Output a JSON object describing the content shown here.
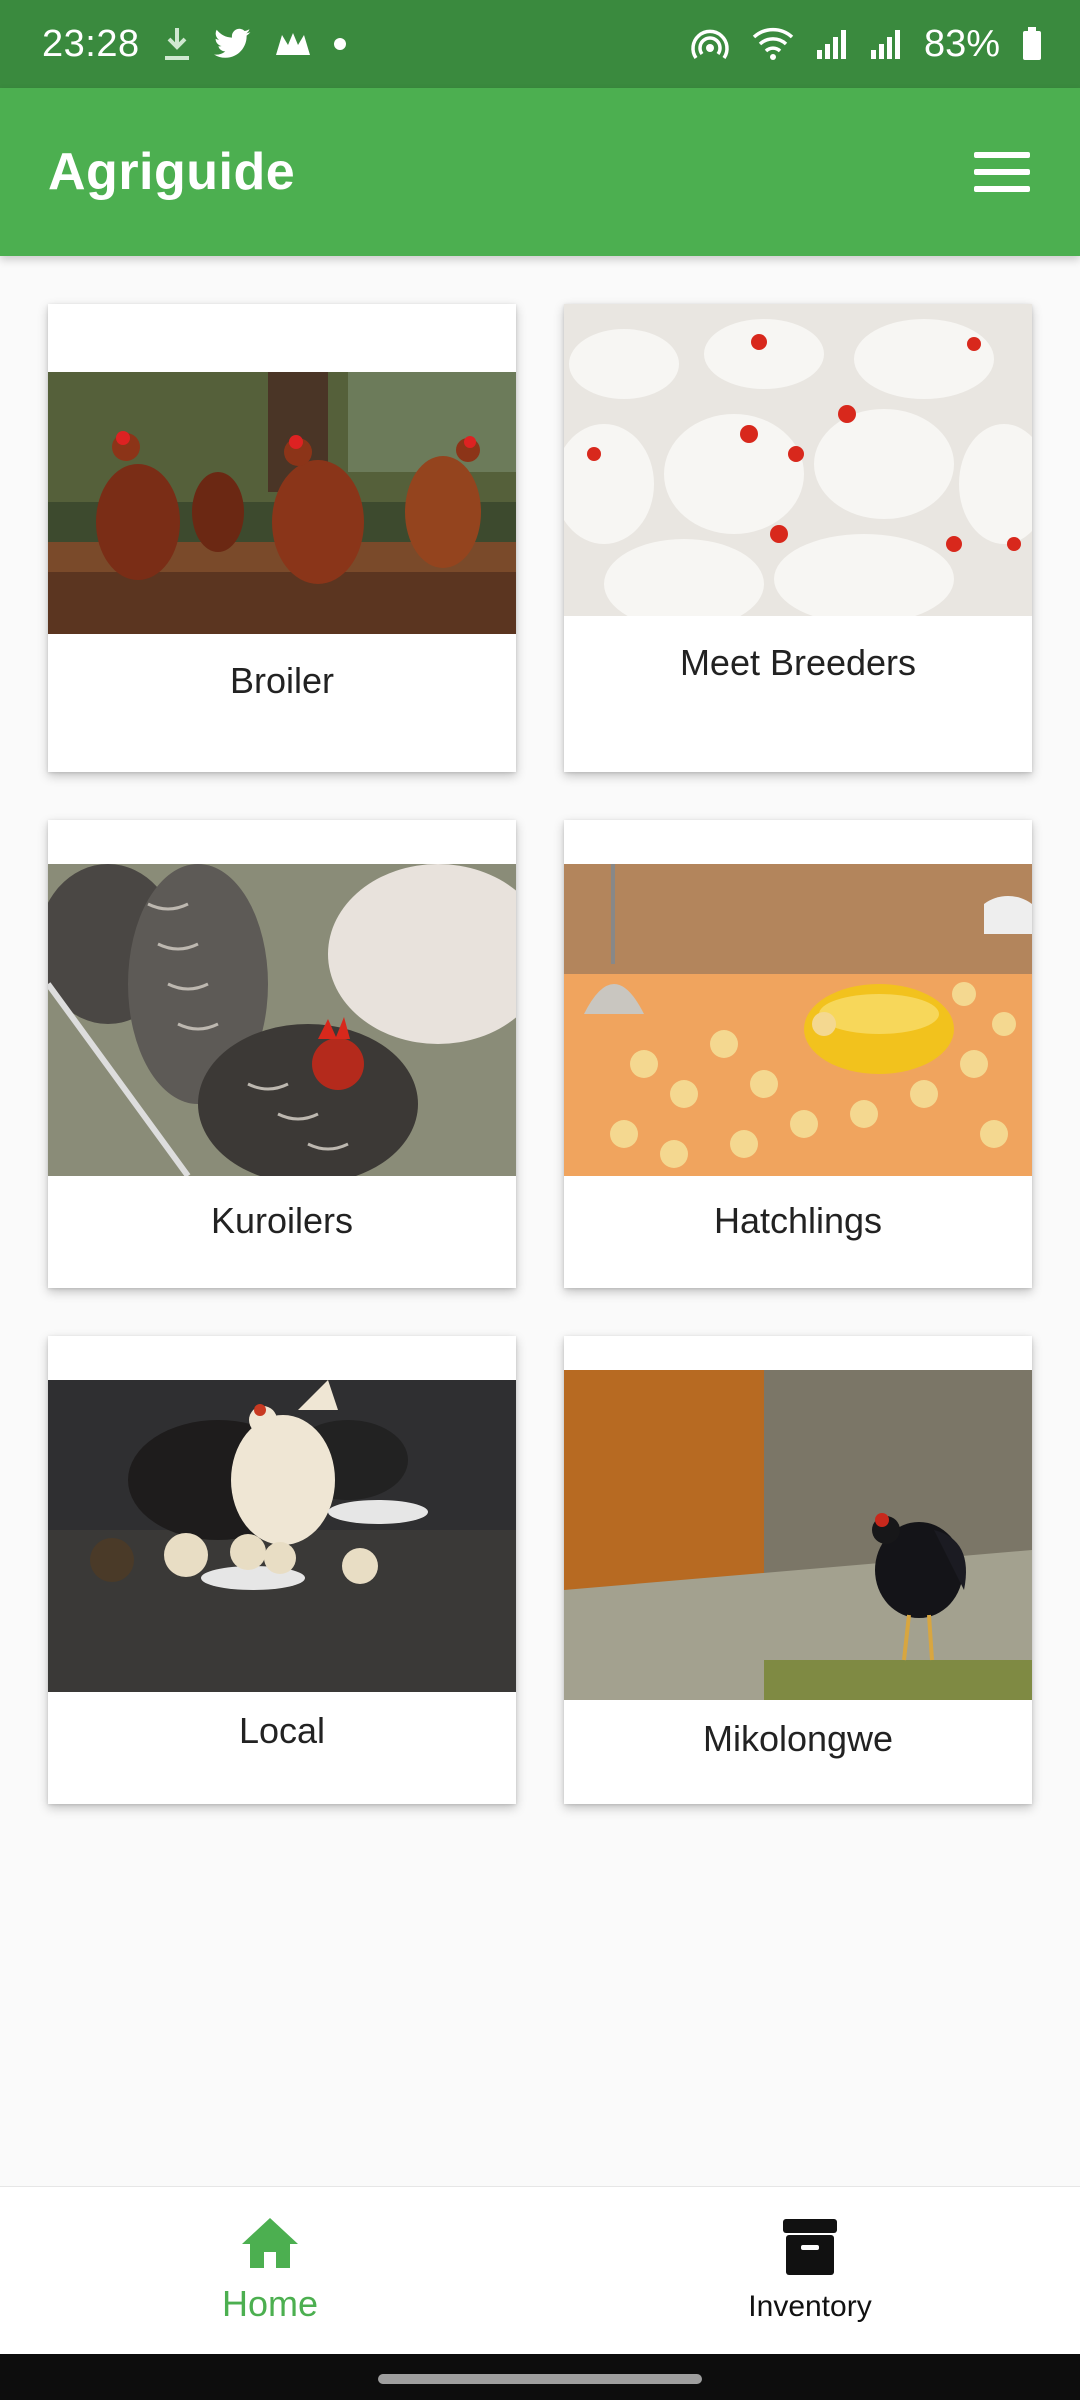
{
  "status_bar": {
    "time": "23:28",
    "battery": "83%",
    "icons_left": [
      "download-icon",
      "twitter-icon",
      "bird-app-icon",
      "notification-dot"
    ],
    "icons_right": [
      "hotspot-icon",
      "wifi-icon",
      "signal-icon",
      "signal-icon",
      "battery-icon"
    ]
  },
  "app_bar": {
    "title": "Agriguide",
    "menu_icon": "hamburger-menu-icon",
    "color": "#4caf50"
  },
  "cards": [
    {
      "label": "Broiler",
      "image": "brown hens in a yard"
    },
    {
      "label": "Meet Breeders",
      "image": "flock of white chickens"
    },
    {
      "label": "Kuroilers",
      "image": "speckled chickens pecking"
    },
    {
      "label": "Hatchlings",
      "image": "chicks under heat lamp"
    },
    {
      "label": "Local",
      "image": "hen with chicks and cat"
    },
    {
      "label": "Mikolongwe",
      "image": "black chicken by stone wall"
    }
  ],
  "bottom_nav": {
    "items": [
      {
        "label": "Home",
        "icon": "home-icon",
        "active": true,
        "color": "#4caf50"
      },
      {
        "label": "Inventory",
        "icon": "archive-icon",
        "active": false,
        "color": "#111111"
      }
    ]
  }
}
